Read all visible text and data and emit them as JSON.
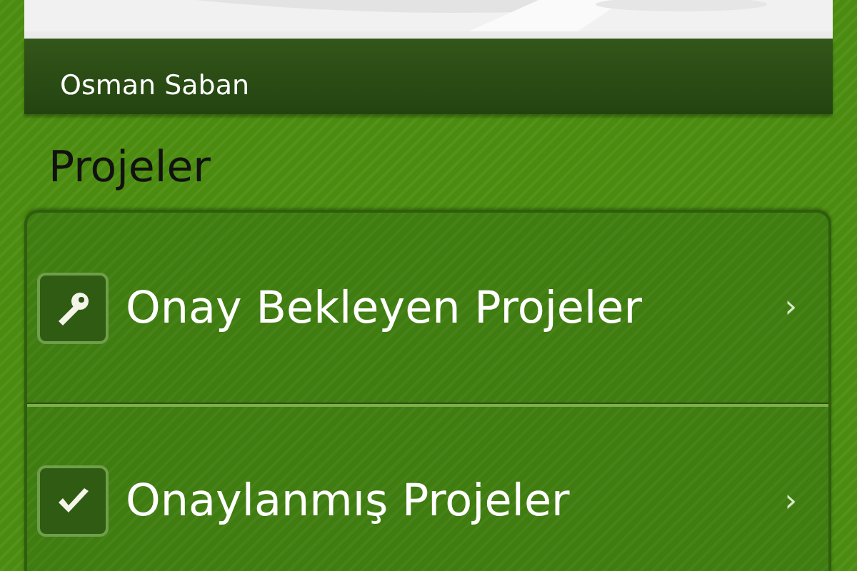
{
  "profile": {
    "name": "Osman Saban"
  },
  "section": {
    "title": "Projeler"
  },
  "items": [
    {
      "label": "Onay Bekleyen Projeler",
      "chevron": "›"
    },
    {
      "label": "Onaylanmış Projeler",
      "chevron": "›"
    }
  ]
}
